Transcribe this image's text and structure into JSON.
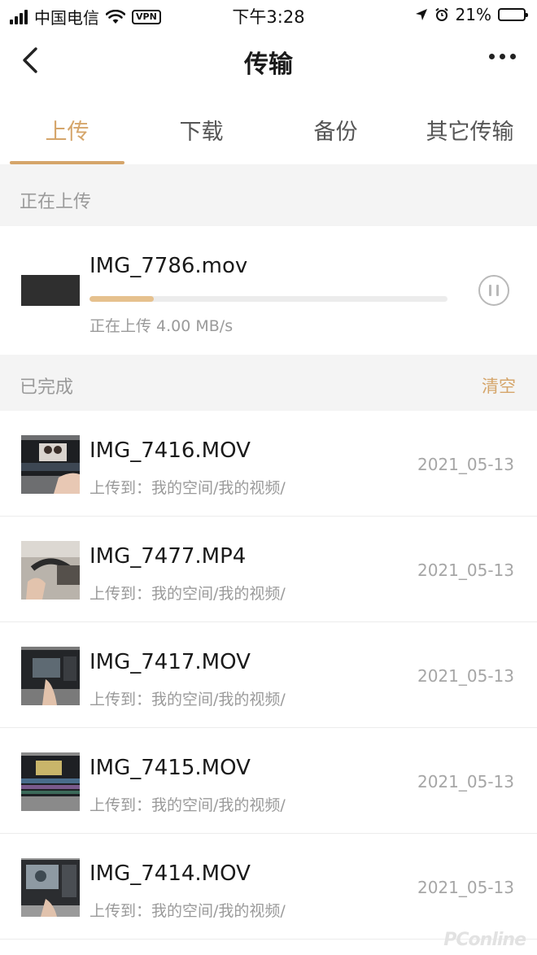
{
  "status_bar": {
    "carrier": "中国电信",
    "vpn": "VPN",
    "time": "下午3:28",
    "battery": "21%",
    "battery_level": 0.21
  },
  "nav": {
    "title": "传输",
    "back_icon": "chevron-left-icon",
    "more_icon": "more-icon"
  },
  "tabs": [
    {
      "label": "上传",
      "active": true
    },
    {
      "label": "下载",
      "active": false
    },
    {
      "label": "备份",
      "active": false
    },
    {
      "label": "其它传输",
      "active": false
    }
  ],
  "uploading_section": {
    "title": "正在上传",
    "item": {
      "file_name": "IMG_7786.mov",
      "progress": 0.18,
      "status": "正在上传 4.00 MB/s",
      "pause_icon": "pause-icon"
    }
  },
  "completed_section": {
    "title": "已完成",
    "clear_label": "清空",
    "items": [
      {
        "file_name": "IMG_7416.MOV",
        "destination": "上传到：我的空间/我的视频/",
        "date": "2021_05-13"
      },
      {
        "file_name": "IMG_7477.MP4",
        "destination": "上传到：我的空间/我的视频/",
        "date": "2021_05-13"
      },
      {
        "file_name": "IMG_7417.MOV",
        "destination": "上传到：我的空间/我的视频/",
        "date": "2021_05-13"
      },
      {
        "file_name": "IMG_7415.MOV",
        "destination": "上传到：我的空间/我的视频/",
        "date": "2021_05-13"
      },
      {
        "file_name": "IMG_7414.MOV",
        "destination": "上传到：我的空间/我的视频/",
        "date": "2021_05-13"
      }
    ]
  },
  "colors": {
    "accent": "#d5a56a",
    "progress_fill": "#e6c18e",
    "section_bg": "#f4f4f4"
  },
  "watermark": "PConline"
}
